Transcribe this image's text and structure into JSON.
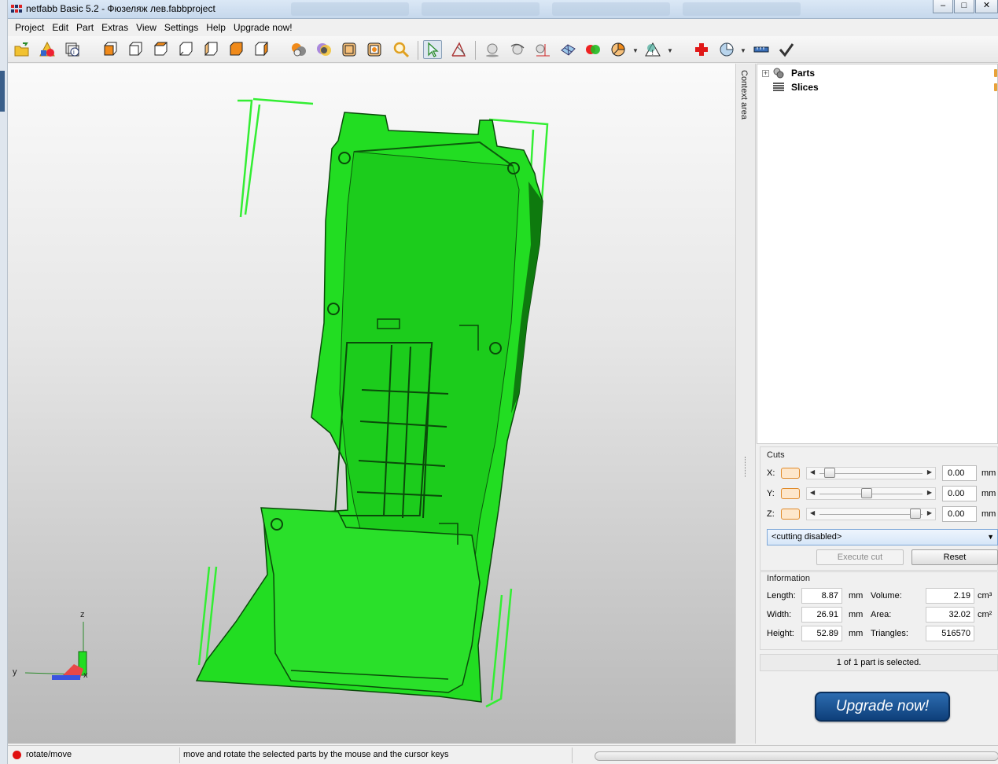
{
  "window": {
    "title": "netfabb Basic 5.2 - Фюзеляж лев.fabbproject",
    "controls": [
      "–",
      "□",
      "✕"
    ]
  },
  "menu": [
    "Project",
    "Edit",
    "Part",
    "Extras",
    "View",
    "Settings",
    "Help",
    "Upgrade now!"
  ],
  "toolbar": {
    "icons": [
      "open-folder-icon",
      "add-part-icon",
      "part-info-icon",
      "view-front-icon",
      "view-back-icon",
      "view-left-icon",
      "view-right-icon",
      "view-top-icon",
      "view-bottom-icon",
      "view-iso-icon",
      "shaded-view-icon",
      "color-view-icon",
      "wireframe-icon",
      "zoom-all-icon",
      "zoom-icon",
      "select-pointer-icon",
      "measure-icon",
      "sphere-icon",
      "rotate-icon",
      "scale-icon",
      "mesh-icon",
      "boolean-icon",
      "pie-chart-icon",
      "warning-icon",
      "repair-cross-icon",
      "analysis-icon",
      "ruler-icon",
      "checkmark-icon"
    ]
  },
  "viewport": {
    "axis_labels": {
      "z": "z",
      "y": "y",
      "x": "x"
    },
    "colors": {
      "part": "#22dd22",
      "bounding_box": "#33ee33"
    }
  },
  "context_area": {
    "label": "Context area"
  },
  "tree": {
    "items": [
      {
        "label": "Parts",
        "icon": "parts-icon",
        "expander": "+"
      },
      {
        "label": "Slices",
        "icon": "slices-icon",
        "expander": ""
      }
    ]
  },
  "cuts": {
    "title": "Cuts",
    "axes": [
      {
        "name": "X:",
        "value": "0.00",
        "unit": "mm",
        "position": 0.05
      },
      {
        "name": "Y:",
        "value": "0.00",
        "unit": "mm",
        "position": 0.45
      },
      {
        "name": "Z:",
        "value": "0.00",
        "unit": "mm",
        "position": 0.98
      }
    ],
    "mode": "<cutting disabled>",
    "execute_label": "Execute cut",
    "reset_label": "Reset"
  },
  "information": {
    "title": "Information",
    "length_label": "Length:",
    "length_value": "8.87",
    "length_unit": "mm",
    "width_label": "Width:",
    "width_value": "26.91",
    "width_unit": "mm",
    "height_label": "Height:",
    "height_value": "52.89",
    "height_unit": "mm",
    "volume_label": "Volume:",
    "volume_value": "2.19",
    "volume_unit": "cm³",
    "area_label": "Area:",
    "area_value": "32.02",
    "area_unit": "cm²",
    "triangles_label": "Triangles:",
    "triangles_value": "516570"
  },
  "selection_status": "1 of 1 part is selected.",
  "upgrade_label": "Upgrade now!",
  "statusbar": {
    "mode": "rotate/move",
    "message": "move and rotate the selected parts by the mouse and the cursor keys"
  }
}
